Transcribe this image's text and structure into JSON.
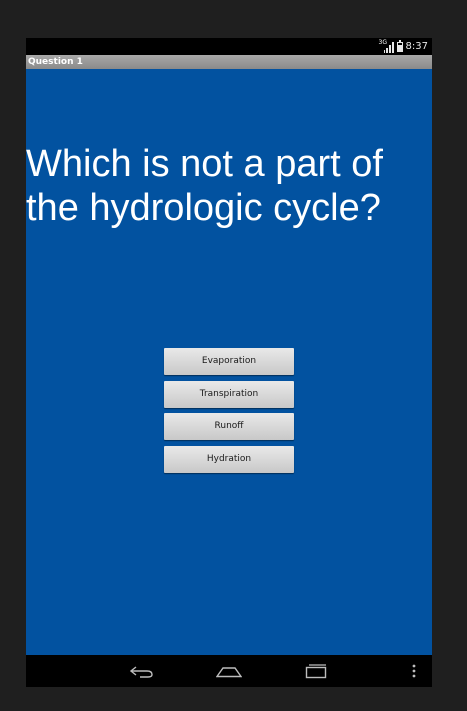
{
  "status_bar": {
    "network_label": "3G",
    "time": "8:37",
    "icons": [
      "signal-icon",
      "battery-icon"
    ]
  },
  "title_bar": {
    "title": "Question 1"
  },
  "question": {
    "text": "Which is not a part of the hydrologic cycle?"
  },
  "answers": [
    {
      "label": "Evaporation"
    },
    {
      "label": "Transpiration"
    },
    {
      "label": "Runoff"
    },
    {
      "label": "Hydration"
    }
  ],
  "nav_bar": {
    "icons": [
      "back-icon",
      "home-icon",
      "recent-apps-icon",
      "overflow-menu-icon"
    ]
  },
  "colors": {
    "content_background": "#0252a0",
    "title_bar": "#9a9a9a",
    "button": "#d8d8d8",
    "device_frame": "#1f1f1f"
  }
}
